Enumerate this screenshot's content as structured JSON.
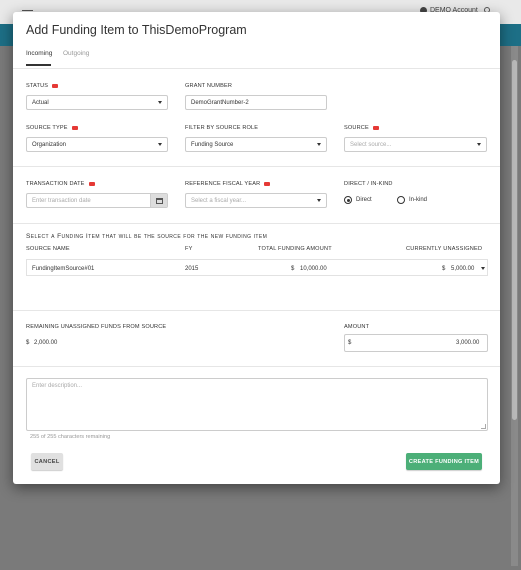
{
  "app": {
    "account_label": "DEMO Account"
  },
  "dialog": {
    "title": "Add Funding Item to ThisDemoProgram",
    "tabs": [
      {
        "label": "Incoming",
        "active": true
      },
      {
        "label": "Outgoing",
        "active": false
      }
    ]
  },
  "form": {
    "status": {
      "label": "STATUS",
      "value": "Actual",
      "required": true
    },
    "grant_number": {
      "label": "GRANT NUMBER",
      "value": "DemoGrantNumber-2"
    },
    "source_type": {
      "label": "SOURCE TYPE",
      "value": "Organization",
      "required": true
    },
    "filter_by_source_role": {
      "label": "FILTER BY SOURCE ROLE",
      "value": "Funding Source"
    },
    "source": {
      "label": "SOURCE",
      "placeholder": "Select source...",
      "required": true
    },
    "transaction_date": {
      "label": "TRANSACTION DATE",
      "placeholder": "Enter transaction date",
      "required": true
    },
    "reference_fiscal_year": {
      "label": "REFERENCE FISCAL YEAR",
      "placeholder": "Select a fiscal year...",
      "required": true
    },
    "direct_in_kind": {
      "label": "DIRECT / IN-KIND",
      "options": [
        {
          "label": "Direct",
          "selected": true
        },
        {
          "label": "In-kind",
          "selected": false
        }
      ]
    }
  },
  "source_table": {
    "heading": "Select a Funding Item that will be the source for the new funding item",
    "columns": [
      "SOURCE NAME",
      "FY",
      "TOTAL FUNDING AMOUNT",
      "CURRENTLY UNASSIGNED"
    ],
    "rows": [
      {
        "source_name": "FundingItemSource#01",
        "fy": "2015",
        "currency": "$",
        "total": "10,000.00",
        "unassigned": "5,000.00"
      }
    ]
  },
  "remaining": {
    "label": "REMAINING UNASSIGNED FUNDS FROM SOURCE",
    "currency": "$",
    "value": "2,000.00"
  },
  "amount": {
    "label": "AMOUNT",
    "currency": "$",
    "value": "3,000.00"
  },
  "description": {
    "placeholder": "Enter description...",
    "helper": "255 of 255 characters remaining"
  },
  "actions": {
    "cancel_label": "CANCEL",
    "create_label": "CREATE FUNDING ITEM"
  },
  "colors": {
    "accent_green": "#4caf78",
    "required_red": "#e53935",
    "app_band": "#1d6f86"
  }
}
